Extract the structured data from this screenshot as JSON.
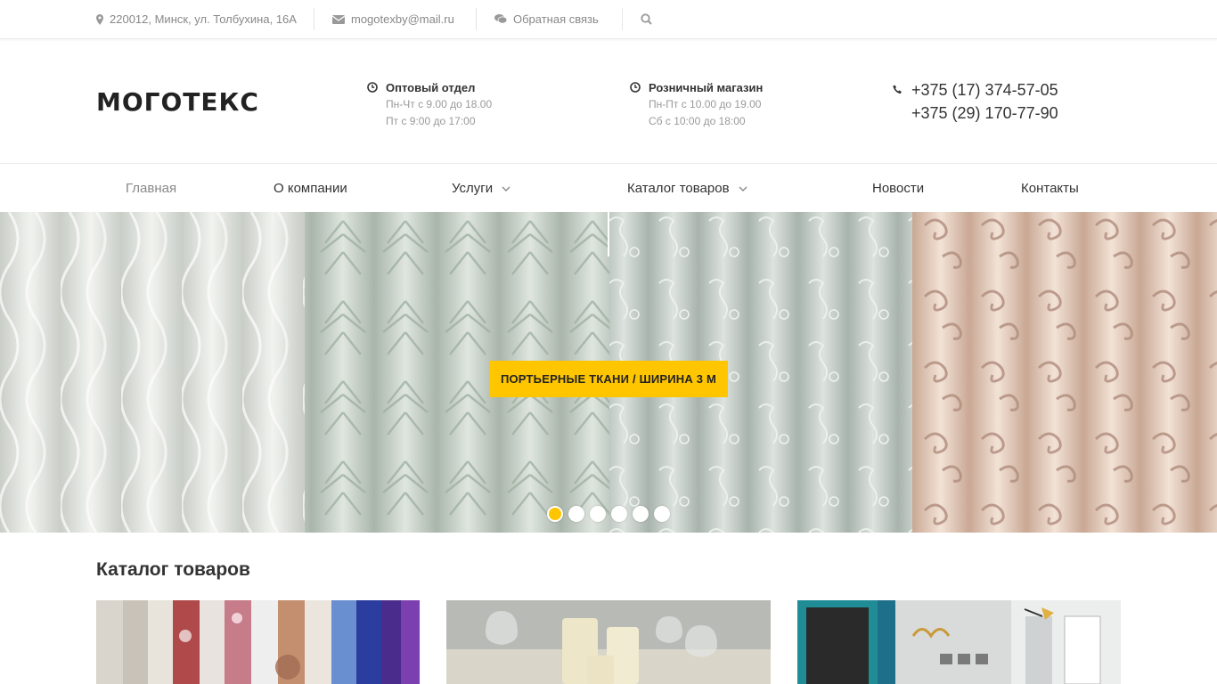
{
  "topbar": {
    "address": "220012, Минск, ул. Толбухина, 16А",
    "email": "mogotexby@mail.ru",
    "feedback": "Обратная связь"
  },
  "header": {
    "logo": "МОГОТЕКС",
    "wholesale": {
      "title": "Оптовый отдел",
      "line1": "Пн-Чт с 9.00 до 18.00",
      "line2": "Пт с 9:00 до 17:00"
    },
    "retail": {
      "title": "Розничный магазин",
      "line1": "Пн-Пт с 10.00 до 19.00",
      "line2": "Сб с 10:00 до 18:00"
    },
    "phones": [
      "+375 (17) 374-57-05",
      "+375 (29) 170-77-90"
    ]
  },
  "nav": [
    {
      "label": "Главная",
      "active": true,
      "dropdown": false
    },
    {
      "label": "О компании",
      "active": false,
      "dropdown": false
    },
    {
      "label": "Услуги",
      "active": false,
      "dropdown": true
    },
    {
      "label": "Каталог товаров",
      "active": false,
      "dropdown": true
    },
    {
      "label": "Новости",
      "active": false,
      "dropdown": false
    },
    {
      "label": "Контакты",
      "active": false,
      "dropdown": false
    }
  ],
  "slider": {
    "cta": "ПОРТЬЕРНЫЕ ТКАНИ / ШИРИНА 3 М",
    "slide_count": 6,
    "active_slide": 1
  },
  "catalog": {
    "title": "Каталог товаров"
  },
  "colors": {
    "accent": "#ffc600",
    "text": "#333333",
    "muted": "#888888"
  },
  "icons": {
    "address": "map-marker-icon",
    "email": "envelope-icon",
    "feedback": "comments-icon",
    "search": "search-icon",
    "hours": "clock-icon",
    "phone": "phone-icon",
    "dropdown": "chevron-down-icon"
  }
}
